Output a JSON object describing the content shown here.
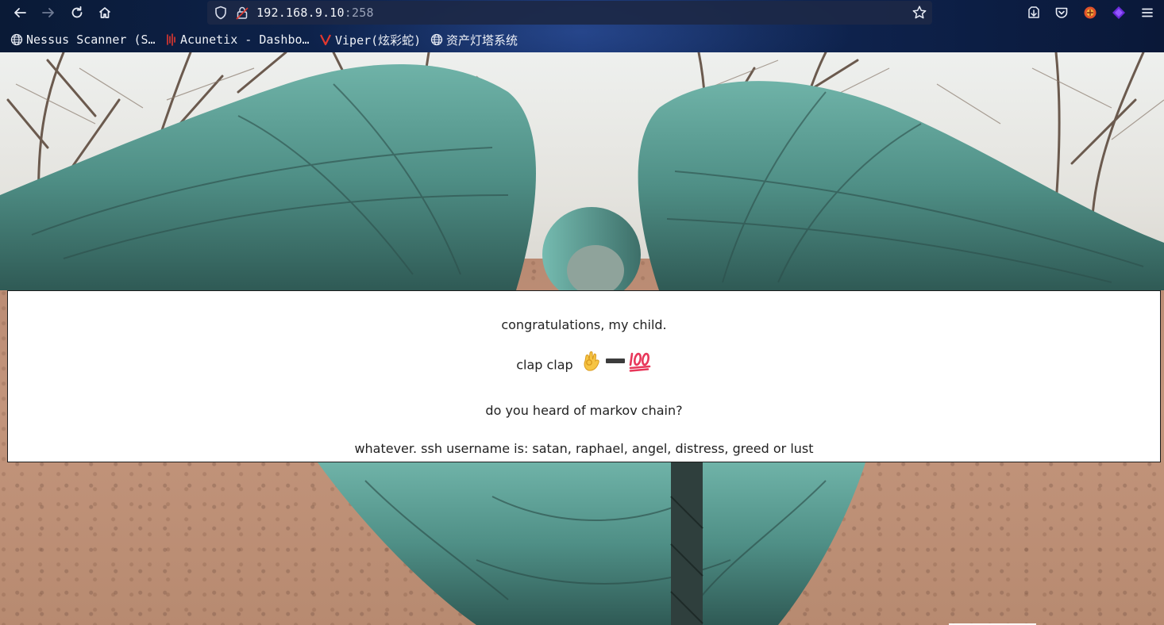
{
  "browser": {
    "url_host": "192.168.9.10",
    "url_port": ":258",
    "nav_icons": [
      "back-arrow-icon",
      "forward-arrow-icon",
      "reload-icon",
      "home-icon"
    ],
    "right_icons": [
      "save-to-pocket-icon",
      "pocket-icon",
      "extension-icon",
      "extension-diamond-icon",
      "menu-icon"
    ],
    "bookmarks": [
      {
        "label": "Nessus Scanner (S…",
        "icon": "globe-icon"
      },
      {
        "label": "Acunetix - Dashbo…",
        "icon": "acunetix-icon"
      },
      {
        "label": "Viper(炫彩蛇)",
        "icon": "viper-icon"
      },
      {
        "label": "资产灯塔系统",
        "icon": "globe-icon"
      }
    ]
  },
  "page": {
    "line1": "congratulations, my child.",
    "line2_text": "clap clap",
    "line2_emojis": [
      "ok-hand-emoji",
      "heavy-minus-emoji",
      "hundred-points-emoji"
    ],
    "line3": "do you heard of markov chain?",
    "line4": "whatever. ssh username is: satan, raphael, angel, distress, greed or lust"
  },
  "colors": {
    "chrome_bg": "#0e2450",
    "urlbar_bg": "#1c2846",
    "statue_patina": "#5fa39a",
    "stone": "#bf927a",
    "box_border": "#1d1d1d"
  }
}
